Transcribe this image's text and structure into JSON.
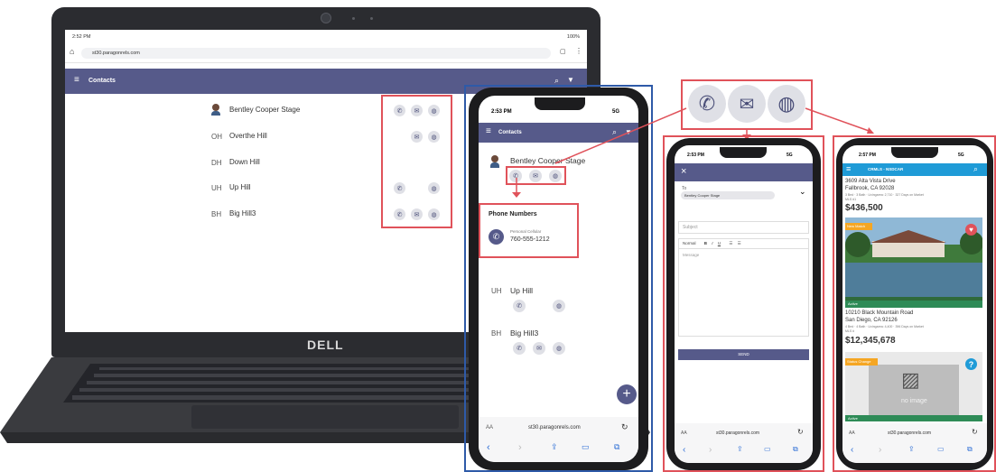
{
  "laptop": {
    "status_time": "2:52 PM",
    "battery": "100%",
    "url": "st30.paragonrels.com",
    "app_title": "Contacts",
    "brand": "DELL",
    "contacts": [
      {
        "initials": "",
        "name": "Bentley Cooper Stage",
        "has_avatar": true,
        "actions": [
          "phone",
          "mail",
          "web"
        ]
      },
      {
        "initials": "OH",
        "name": "Overthe Hill",
        "actions": [
          "mail",
          "web"
        ]
      },
      {
        "initials": "DH",
        "name": "Down Hill",
        "actions": []
      },
      {
        "initials": "UH",
        "name": "Up Hill",
        "actions": [
          "phone",
          "web"
        ]
      },
      {
        "initials": "BH",
        "name": "Big Hill3",
        "actions": [
          "phone",
          "mail",
          "web"
        ]
      }
    ]
  },
  "phone1": {
    "time": "2:53 PM",
    "signal": "5G",
    "app_title": "Contacts",
    "contact_top": "Bentley Cooper Stage",
    "phone_section_title": "Phone Numbers",
    "phone_type": "Personal Cellular",
    "phone_number": "760-555-1212",
    "contacts": [
      {
        "initials": "UH",
        "name": "Up Hill"
      },
      {
        "initials": "BH",
        "name": "Big Hill3"
      }
    ],
    "url": "st30.paragonrels.com",
    "aa": "AA"
  },
  "phone2": {
    "time": "2:53 PM",
    "signal": "5G",
    "to_label": "To",
    "to_chip": "Bentley Cooper Stage",
    "subject_placeholder": "Subject",
    "format_label": "Normal",
    "message_placeholder": "Message",
    "send_label": "SEND",
    "url": "st30.paragonrels.com",
    "aa": "AA"
  },
  "phone3": {
    "time": "2:57 PM",
    "signal": "5G",
    "app_title": "CRMLS - NSDCAR",
    "listing1": {
      "address1": "3609 Alta Vista Drive",
      "address2": "Fallbrook, CA 92028",
      "details": "3 Bed · 3 Bath · Livingarea: 2,710 · 327 Days on Market",
      "mls": "MLS #1",
      "price": "$436,500",
      "badge": "New Match",
      "status": "Active"
    },
    "listing2": {
      "address1": "10210 Black Mountain Road",
      "address2": "San Diego, CA 92126",
      "details": "4 Bed · 4 Bath · Livingarea: 4,400 · 396 Days on Market",
      "mls": "MLS #",
      "price": "$12,345,678",
      "badge": "Status Change",
      "status": "Active",
      "noimage": "no image"
    },
    "url": "st30.paragonrels.com",
    "aa": "AA"
  },
  "colors": {
    "accent": "#565a8a",
    "highlight_red": "#e0525a",
    "highlight_blue": "#2e5aa8"
  }
}
